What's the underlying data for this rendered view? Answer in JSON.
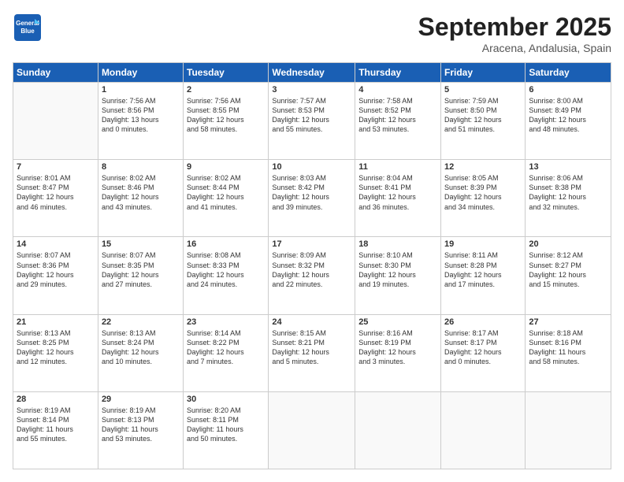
{
  "logo": {
    "line1": "General",
    "line2": "Blue"
  },
  "title": "September 2025",
  "location": "Aracena, Andalusia, Spain",
  "days_header": [
    "Sunday",
    "Monday",
    "Tuesday",
    "Wednesday",
    "Thursday",
    "Friday",
    "Saturday"
  ],
  "weeks": [
    [
      {
        "num": "",
        "info": ""
      },
      {
        "num": "1",
        "info": "Sunrise: 7:56 AM\nSunset: 8:56 PM\nDaylight: 13 hours\nand 0 minutes."
      },
      {
        "num": "2",
        "info": "Sunrise: 7:56 AM\nSunset: 8:55 PM\nDaylight: 12 hours\nand 58 minutes."
      },
      {
        "num": "3",
        "info": "Sunrise: 7:57 AM\nSunset: 8:53 PM\nDaylight: 12 hours\nand 55 minutes."
      },
      {
        "num": "4",
        "info": "Sunrise: 7:58 AM\nSunset: 8:52 PM\nDaylight: 12 hours\nand 53 minutes."
      },
      {
        "num": "5",
        "info": "Sunrise: 7:59 AM\nSunset: 8:50 PM\nDaylight: 12 hours\nand 51 minutes."
      },
      {
        "num": "6",
        "info": "Sunrise: 8:00 AM\nSunset: 8:49 PM\nDaylight: 12 hours\nand 48 minutes."
      }
    ],
    [
      {
        "num": "7",
        "info": "Sunrise: 8:01 AM\nSunset: 8:47 PM\nDaylight: 12 hours\nand 46 minutes."
      },
      {
        "num": "8",
        "info": "Sunrise: 8:02 AM\nSunset: 8:46 PM\nDaylight: 12 hours\nand 43 minutes."
      },
      {
        "num": "9",
        "info": "Sunrise: 8:02 AM\nSunset: 8:44 PM\nDaylight: 12 hours\nand 41 minutes."
      },
      {
        "num": "10",
        "info": "Sunrise: 8:03 AM\nSunset: 8:42 PM\nDaylight: 12 hours\nand 39 minutes."
      },
      {
        "num": "11",
        "info": "Sunrise: 8:04 AM\nSunset: 8:41 PM\nDaylight: 12 hours\nand 36 minutes."
      },
      {
        "num": "12",
        "info": "Sunrise: 8:05 AM\nSunset: 8:39 PM\nDaylight: 12 hours\nand 34 minutes."
      },
      {
        "num": "13",
        "info": "Sunrise: 8:06 AM\nSunset: 8:38 PM\nDaylight: 12 hours\nand 32 minutes."
      }
    ],
    [
      {
        "num": "14",
        "info": "Sunrise: 8:07 AM\nSunset: 8:36 PM\nDaylight: 12 hours\nand 29 minutes."
      },
      {
        "num": "15",
        "info": "Sunrise: 8:07 AM\nSunset: 8:35 PM\nDaylight: 12 hours\nand 27 minutes."
      },
      {
        "num": "16",
        "info": "Sunrise: 8:08 AM\nSunset: 8:33 PM\nDaylight: 12 hours\nand 24 minutes."
      },
      {
        "num": "17",
        "info": "Sunrise: 8:09 AM\nSunset: 8:32 PM\nDaylight: 12 hours\nand 22 minutes."
      },
      {
        "num": "18",
        "info": "Sunrise: 8:10 AM\nSunset: 8:30 PM\nDaylight: 12 hours\nand 19 minutes."
      },
      {
        "num": "19",
        "info": "Sunrise: 8:11 AM\nSunset: 8:28 PM\nDaylight: 12 hours\nand 17 minutes."
      },
      {
        "num": "20",
        "info": "Sunrise: 8:12 AM\nSunset: 8:27 PM\nDaylight: 12 hours\nand 15 minutes."
      }
    ],
    [
      {
        "num": "21",
        "info": "Sunrise: 8:13 AM\nSunset: 8:25 PM\nDaylight: 12 hours\nand 12 minutes."
      },
      {
        "num": "22",
        "info": "Sunrise: 8:13 AM\nSunset: 8:24 PM\nDaylight: 12 hours\nand 10 minutes."
      },
      {
        "num": "23",
        "info": "Sunrise: 8:14 AM\nSunset: 8:22 PM\nDaylight: 12 hours\nand 7 minutes."
      },
      {
        "num": "24",
        "info": "Sunrise: 8:15 AM\nSunset: 8:21 PM\nDaylight: 12 hours\nand 5 minutes."
      },
      {
        "num": "25",
        "info": "Sunrise: 8:16 AM\nSunset: 8:19 PM\nDaylight: 12 hours\nand 3 minutes."
      },
      {
        "num": "26",
        "info": "Sunrise: 8:17 AM\nSunset: 8:17 PM\nDaylight: 12 hours\nand 0 minutes."
      },
      {
        "num": "27",
        "info": "Sunrise: 8:18 AM\nSunset: 8:16 PM\nDaylight: 11 hours\nand 58 minutes."
      }
    ],
    [
      {
        "num": "28",
        "info": "Sunrise: 8:19 AM\nSunset: 8:14 PM\nDaylight: 11 hours\nand 55 minutes."
      },
      {
        "num": "29",
        "info": "Sunrise: 8:19 AM\nSunset: 8:13 PM\nDaylight: 11 hours\nand 53 minutes."
      },
      {
        "num": "30",
        "info": "Sunrise: 8:20 AM\nSunset: 8:11 PM\nDaylight: 11 hours\nand 50 minutes."
      },
      {
        "num": "",
        "info": ""
      },
      {
        "num": "",
        "info": ""
      },
      {
        "num": "",
        "info": ""
      },
      {
        "num": "",
        "info": ""
      }
    ]
  ]
}
